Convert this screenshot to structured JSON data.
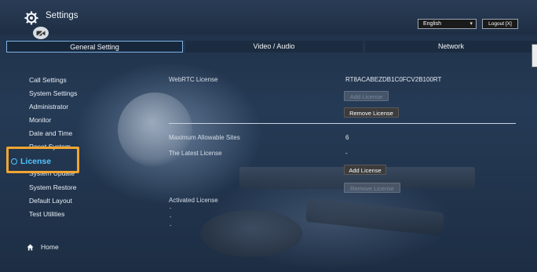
{
  "header": {
    "title": "Settings",
    "language_value": "English",
    "logout_label": "Logout [X]"
  },
  "tabs": [
    {
      "label": "General Setting",
      "active": true
    },
    {
      "label": "Video / Audio",
      "active": false
    },
    {
      "label": "Network",
      "active": false
    }
  ],
  "sidebar": {
    "items": [
      {
        "label": "Call Settings"
      },
      {
        "label": "System Settings"
      },
      {
        "label": "Administrator"
      },
      {
        "label": "Monitor"
      },
      {
        "label": "Date and Time"
      },
      {
        "label": "Reset System"
      },
      {
        "label": "License",
        "active": true
      },
      {
        "label": "System Update"
      },
      {
        "label": "System Restore"
      },
      {
        "label": "Default Layout"
      },
      {
        "label": "Test Utilities"
      }
    ],
    "home_label": "Home"
  },
  "content": {
    "webrtc_label": "WebRTC License",
    "webrtc_value": "RT8ACABEZDB1C0FCV2B100RT",
    "add_license_label": "Add License",
    "remove_license_label": "Remove License",
    "max_sites_label": "Maximum Allowable Sites",
    "max_sites_value": "6",
    "latest_label": "The Latest License",
    "latest_value": "-",
    "add_license_label_2": "Add License",
    "remove_license_label_2": "Remove License",
    "activated_label": "Activated License",
    "activated_values": [
      "-",
      "-",
      "-"
    ]
  },
  "colors": {
    "accent": "#53c4ff",
    "highlight_box": "#f1a532",
    "tab_border": "#7fb3e6"
  }
}
